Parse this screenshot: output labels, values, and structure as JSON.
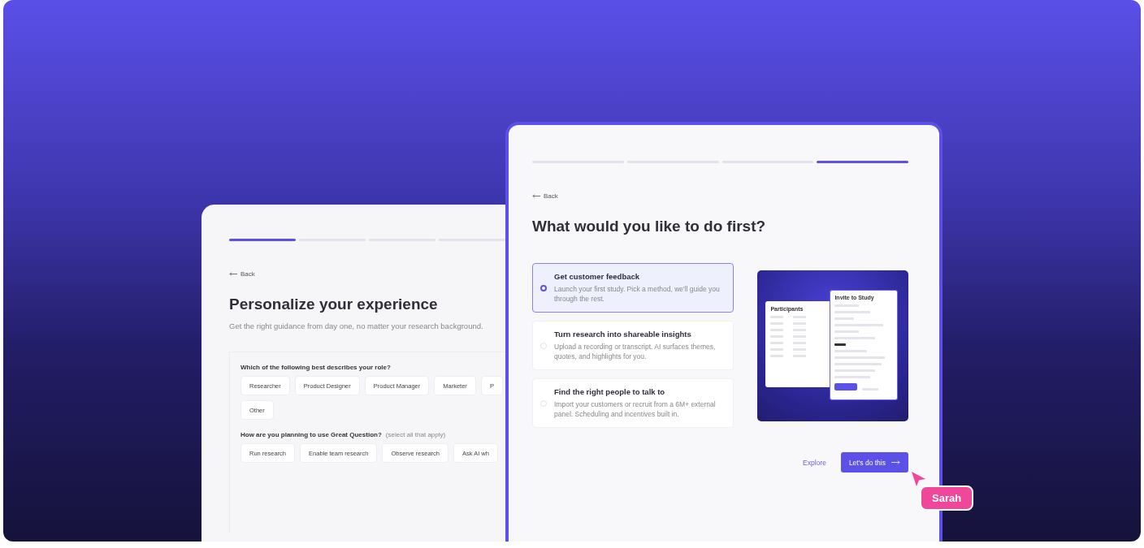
{
  "back_card": {
    "steps": [
      {
        "active": true
      },
      {
        "active": false
      },
      {
        "active": false
      },
      {
        "active": false
      }
    ],
    "back_label": "Back",
    "title": "Personalize your experience",
    "subtitle": "Get the right guidance from day one, no matter your research background.",
    "questions": [
      {
        "label": "Which of the following best describes your role?",
        "rows": [
          [
            "Researcher",
            "Product Designer",
            "Product Manager",
            "Marketer",
            "P"
          ],
          [
            "Other"
          ]
        ]
      },
      {
        "label": "How are you planning to use Great Question?",
        "hint": "(select all that apply)",
        "rows": [
          [
            "Run research",
            "Enable team research",
            "Observe research",
            "Ask AI wh"
          ]
        ]
      }
    ]
  },
  "front_card": {
    "steps": [
      {
        "active": false
      },
      {
        "active": false
      },
      {
        "active": false
      },
      {
        "active": true
      }
    ],
    "back_label": "Back",
    "title": "What would you like to do first?",
    "options": [
      {
        "title": "Get customer feedback",
        "description": "Launch your first study. Pick a method, we'll guide you through the rest.",
        "selected": true
      },
      {
        "title": "Turn research into shareable insights",
        "description": "Upload a recording or transcript. AI surfaces themes, quotes, and highlights for you.",
        "selected": false
      },
      {
        "title": "Find the right people to talk to",
        "description": "Import your customers or recruit from a 6M+ external panel. Scheduling and incentives built in.",
        "selected": false
      }
    ],
    "preview": {
      "panel_title": "Participants",
      "dialog_title": "Invite to Study"
    },
    "secondary_action": "Explore",
    "primary_action": "Let's do this"
  },
  "cursor": {
    "name": "Sarah"
  }
}
